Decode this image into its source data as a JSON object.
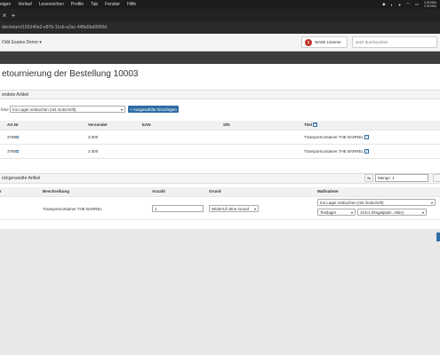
{
  "menubar": {
    "items": [
      "eigen",
      "Verlauf",
      "Lesezeichen",
      "Profile",
      "Tab",
      "Fenster",
      "Hilfe"
    ],
    "net_up": "0.00 KB/s",
    "net_down": "0.03 KB/s"
  },
  "browser": {
    "new_tab": "+",
    "url": "der/return/155340e2-e87b-11eb-a2ac-448a5bd9950d"
  },
  "header": {
    "client_name": "Odd Esates Demo",
    "wawi_badge": "$",
    "wawi_label": "WAWI Listener",
    "search_placeholder": "Jetzt durchsuchen"
  },
  "page": {
    "title": "etournierung der Bestellung 10003"
  },
  "sent_section": {
    "heading": "endete Artikel",
    "action_label": "hme",
    "action_value": "Ins Lager einbuchen (mit Gutschrift)",
    "add_button": "+ Ausgewählte hinzufügen",
    "columns": [
      "Art.Nr",
      "Versendet",
      "EAN",
      "S/N",
      "Titel"
    ],
    "rows": [
      {
        "art": "3788",
        "versendet": "3.000",
        "ean": "",
        "sn": "",
        "titel": "Transportcontainer THE BARREL"
      },
      {
        "art": "3788",
        "versendet": "2.000",
        "ean": "",
        "sn": "",
        "titel": "Transportcontainer THE BARREL"
      }
    ]
  },
  "returned_section": {
    "heading": "ückgesandte Artikel",
    "menge_label": "Menge: 1",
    "columns": [
      "r",
      "Beschreibung",
      "Anzahl",
      "Grund",
      "Maßnahme"
    ],
    "row": {
      "description": "Transportcontainer THE BARREL",
      "quantity": "1",
      "reason": "Widerruf ohne Grund",
      "measure": "Ins Lager einbuchen (mit Gutschrift)",
      "warehouse": "Testlager",
      "location": "1h1r1 (Regalplatz, Aktiv)"
    }
  }
}
